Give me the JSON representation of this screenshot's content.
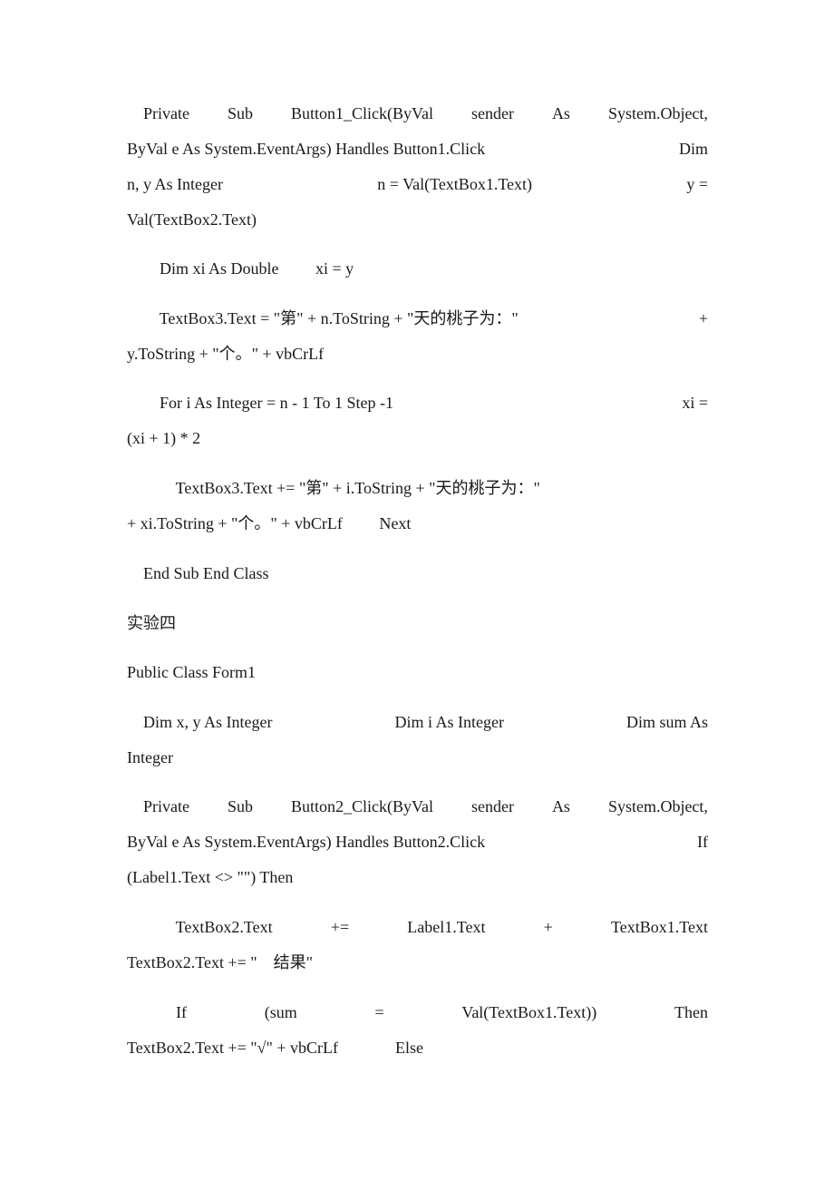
{
  "document": {
    "paragraphs": [
      {
        "id": "button1-click",
        "lines": [
          [
            "    Private",
            "Sub",
            "Button1_Click(ByVal",
            "sender",
            "As",
            "System.Object,"
          ],
          [
            "ByVal e As System.EventArgs) Handles Button1.Click",
            "Dim"
          ],
          [
            "n, y As Integer",
            "n = Val(TextBox1.Text)",
            "y ="
          ],
          [
            "Val(TextBox2.Text)"
          ]
        ]
      },
      {
        "id": "dim-xi",
        "lines": [
          [
            "        Dim xi As Double         xi = y"
          ]
        ]
      },
      {
        "id": "textbox3-assign",
        "lines": [
          [
            "        TextBox3.Text = \"第\" + n.ToString + \"天的桃子为：\"",
            "+"
          ],
          [
            "y.ToString + \"个。\" + vbCrLf"
          ]
        ]
      },
      {
        "id": "for-loop",
        "lines": [
          [
            "        For i As Integer = n - 1 To 1 Step -1",
            "xi ="
          ],
          [
            "(xi + 1) * 2"
          ]
        ]
      },
      {
        "id": "textbox3-append",
        "lines": [
          [
            "            TextBox3.Text += \"第\" + i.ToString + \"天的桃子为：\""
          ],
          [
            "+ xi.ToString + \"个。\" + vbCrLf         Next"
          ]
        ]
      },
      {
        "id": "end-sub",
        "lines": [
          [
            "    End Sub End Class"
          ]
        ]
      },
      {
        "id": "heading-experiment-4",
        "lines": [
          [
            "实验四"
          ]
        ]
      },
      {
        "id": "public-class",
        "lines": [
          [
            "Public Class Form1"
          ]
        ]
      },
      {
        "id": "dim-vars",
        "lines": [
          [
            "    Dim x, y As Integer",
            "Dim i As Integer",
            "Dim sum As"
          ],
          [
            "Integer"
          ]
        ]
      },
      {
        "id": "button2-click",
        "lines": [
          [
            "    Private",
            "Sub",
            "Button2_Click(ByVal",
            "sender",
            "As",
            "System.Object,"
          ],
          [
            "ByVal e As System.EventArgs) Handles Button2.Click",
            "If"
          ],
          [
            "(Label1.Text <> \"\") Then"
          ]
        ]
      },
      {
        "id": "textbox2-append",
        "lines": [
          [
            "            TextBox2.Text",
            "+=",
            "Label1.Text",
            "+",
            "TextBox1.Text"
          ],
          [
            "TextBox2.Text += \"    结果\""
          ]
        ]
      },
      {
        "id": "if-sum",
        "lines": [
          [
            "            If",
            "(sum",
            "=",
            "Val(TextBox1.Text))",
            "Then"
          ],
          [
            "TextBox2.Text += \"√\" + vbCrLf              Else"
          ]
        ]
      }
    ]
  }
}
